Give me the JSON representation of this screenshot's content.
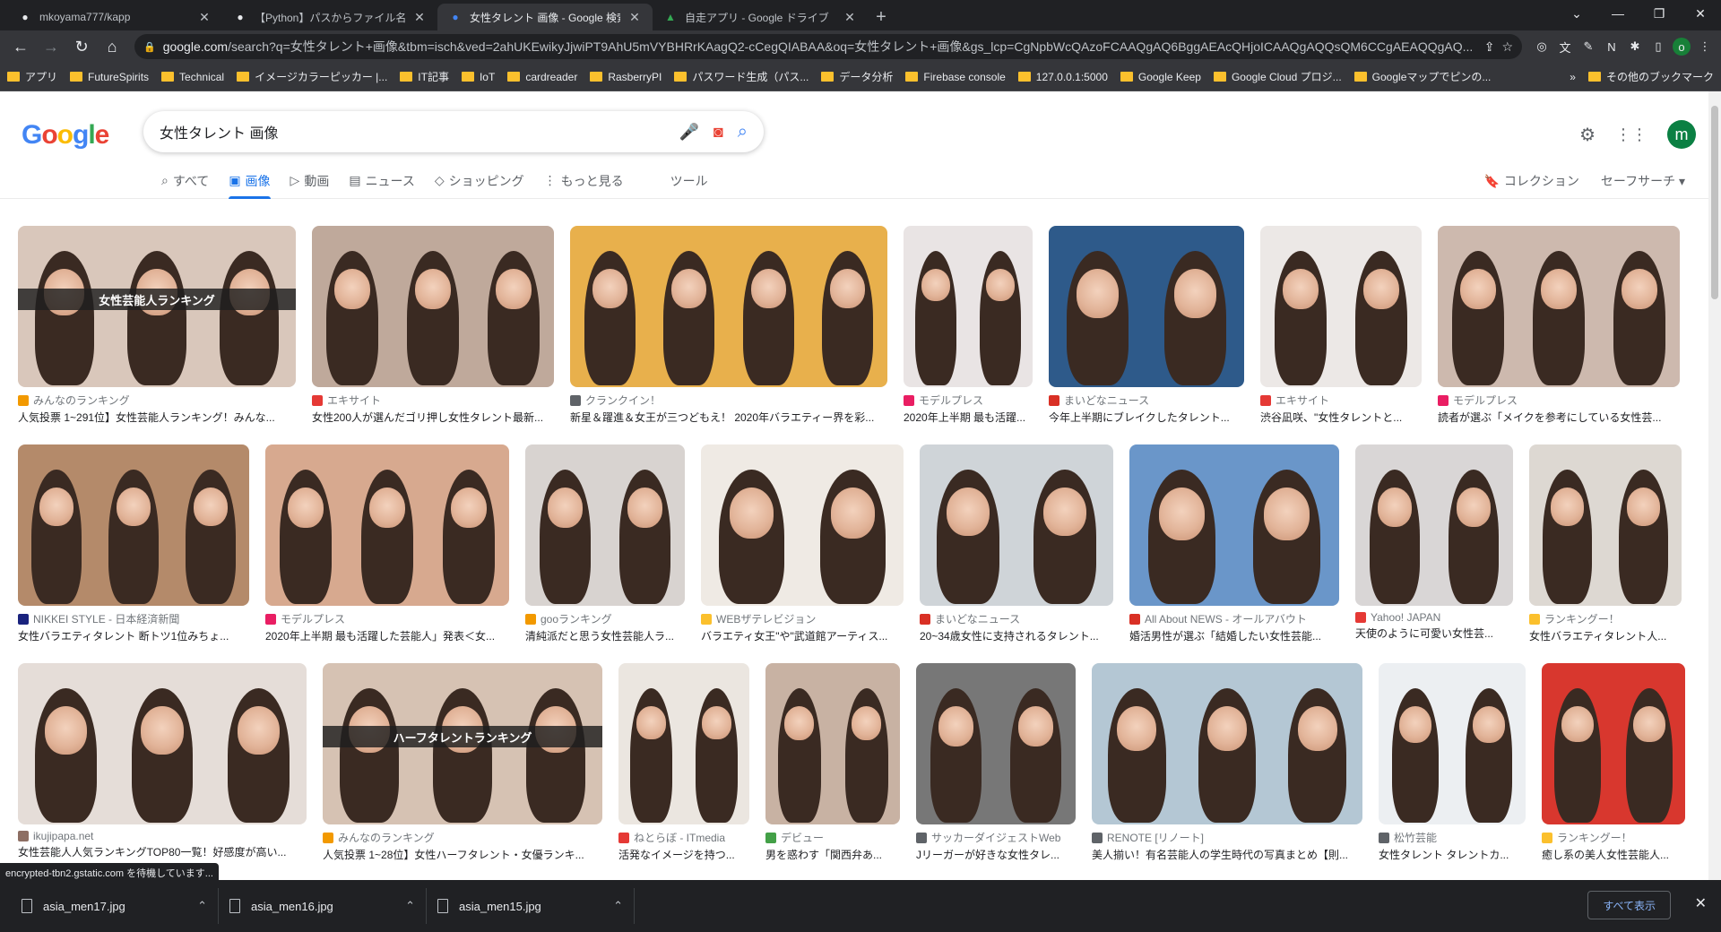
{
  "browser": {
    "tabs": [
      {
        "title": "mkoyama777/kapp",
        "icon": "github-icon",
        "active": false
      },
      {
        "title": "【Python】パスからファイル名（拡張子",
        "icon": "globe-icon",
        "active": false
      },
      {
        "title": "女性タレント 画像 - Google 検索",
        "icon": "google-icon",
        "active": true
      },
      {
        "title": "自走アプリ - Google ドライブ",
        "icon": "drive-icon",
        "active": false
      }
    ],
    "url_domain": "google.com",
    "url_rest": "/search?q=女性タレント+画像&tbm=isch&ved=2ahUKEwikyJjwiPT9AhU5mVYBHRrKAagQ2-cCegQIABAA&oq=女性タレント+画像&gs_lcp=CgNpbWcQAzoFCAAQgAQ6BggAEAcQHjoICAAQgAQQsQM6CCgAEAQQgAQ...",
    "profile_initial": "o",
    "bookmarks": [
      "アプリ",
      "FutureSpirits",
      "Technical",
      "イメージカラーピッカー |...",
      "IT記事",
      "IoT",
      "cardreader",
      "RasberryPI",
      "パスワード生成（パス...",
      "データ分析",
      "Firebase console",
      "127.0.0.1:5000",
      "Google Keep",
      "Google Cloud プロジ...",
      "Googleマップでピンの..."
    ],
    "bookmarks_more": "»",
    "other_bookmarks": "その他のブックマーク"
  },
  "google": {
    "logo": "Google",
    "query": "女性タレント 画像",
    "profile_initial": "m",
    "search_tabs": [
      {
        "label": "すべて",
        "icon": "search-icon",
        "active": false
      },
      {
        "label": "画像",
        "icon": "image-icon",
        "active": true
      },
      {
        "label": "動画",
        "icon": "video-icon",
        "active": false
      },
      {
        "label": "ニュース",
        "icon": "news-icon",
        "active": false
      },
      {
        "label": "ショッピング",
        "icon": "tag-icon",
        "active": false
      },
      {
        "label": "もっと見る",
        "icon": "more-vert-icon",
        "active": false
      }
    ],
    "tools": "ツール",
    "collections": "コレクション",
    "safesearch": "セーフサーチ ▾"
  },
  "results": {
    "row1": [
      {
        "source": "みんなのランキング",
        "title": "人気投票 1~291位】女性芸能人ランキング！みんな...",
        "banner": "女性芸能人ランキング",
        "w": 310,
        "bg": "#d9c7bb",
        "src_color": "#f29900"
      },
      {
        "source": "エキサイト",
        "title": "女性200人が選んだゴリ押し女性タレント最新...",
        "banner": "",
        "w": 270,
        "bg": "#bfa99b",
        "src_color": "#e53935"
      },
      {
        "source": "クランクイン！",
        "title": "新星＆躍進＆女王が三つどもえ！ 2020年バラエティー界を彩...",
        "banner": "",
        "w": 354,
        "bg": "#e8b04c",
        "src_color": "#5f6368"
      },
      {
        "source": "モデルプレス",
        "title": "2020年上半期 最も活躍...",
        "banner": "",
        "w": 144,
        "bg": "#e9e4e4",
        "src_color": "#e91e63"
      },
      {
        "source": "まいどなニュース",
        "title": "今年上半期にブレイクしたタレント...",
        "banner": "",
        "w": 218,
        "bg": "#2e5a8a",
        "src_color": "#d93025"
      },
      {
        "source": "エキサイト",
        "title": "渋谷凪咲、\"女性タレントと...",
        "banner": "",
        "w": 180,
        "bg": "#ece8e6",
        "src_color": "#e53935"
      },
      {
        "source": "モデルプレス",
        "title": "読者が選ぶ「メイクを参考にしている女性芸...",
        "banner": "",
        "w": 270,
        "bg": "#cdb9ae",
        "src_color": "#e91e63"
      }
    ],
    "row2": [
      {
        "source": "NIKKEI STYLE - 日本経済新聞",
        "title": "女性バラエティタレント 断トツ1位みちょ...",
        "banner": "",
        "w": 258,
        "bg": "#b48a6a",
        "src_color": "#1a237e"
      },
      {
        "source": "モデルプレス",
        "title": "2020年上半期 最も活躍した芸能人」発表＜女...",
        "banner": "",
        "w": 272,
        "bg": "#d7a98f",
        "src_color": "#e91e63"
      },
      {
        "source": "gooランキング",
        "title": "清純派だと思う女性芸能人ラ...",
        "banner": "",
        "w": 178,
        "bg": "#d8d3d0",
        "src_color": "#f29900"
      },
      {
        "source": "WEBザテレビジョン",
        "title": "バラエティ女王\"や\"武道館アーティス...",
        "banner": "",
        "w": 226,
        "bg": "#efeae4",
        "src_color": "#fbc02d"
      },
      {
        "source": "まいどなニュース",
        "title": "20~34歳女性に支持されるタレント...",
        "banner": "",
        "w": 216,
        "bg": "#cfd4d8",
        "src_color": "#d93025"
      },
      {
        "source": "All About NEWS - オールアバウト",
        "title": "婚活男性が選ぶ「結婚したい女性芸能...",
        "banner": "",
        "w": 234,
        "bg": "#6a96c9",
        "src_color": "#d93025"
      },
      {
        "source": "Yahoo! JAPAN",
        "title": "天使のように可愛い女性芸...",
        "banner": "",
        "w": 176,
        "bg": "#d9d6d6",
        "src_color": "#e53935"
      },
      {
        "source": "ランキングー！",
        "title": "女性バラエティタレント人...",
        "banner": "",
        "w": 170,
        "bg": "#ddd8d2",
        "src_color": "#fbc02d"
      }
    ],
    "row3": [
      {
        "source": "ikujipapa.net",
        "title": "女性芸能人人気ランキングTOP80一覧！好感度が高い...",
        "banner": "",
        "w": 322,
        "bg": "#e5ddd8",
        "src_color": "#8d6e63"
      },
      {
        "source": "みんなのランキング",
        "title": "人気投票 1~28位】女性ハーフタレント・女優ランキ...",
        "banner": "ハーフタレントランキング",
        "w": 312,
        "bg": "#d6c2b3",
        "src_color": "#f29900"
      },
      {
        "source": "ねとらぼ - ITmedia",
        "title": "活発なイメージを持つ...",
        "banner": "",
        "w": 146,
        "bg": "#ebe6e0",
        "src_color": "#e53935"
      },
      {
        "source": "デビュー",
        "title": "男を惑わす「関西弁あ...",
        "banner": "",
        "w": 150,
        "bg": "#c8b2a3",
        "src_color": "#43a047"
      },
      {
        "source": "サッカーダイジェストWeb",
        "title": "Jリーガーが好きな女性タレ...",
        "banner": "",
        "w": 178,
        "bg": "#777777",
        "src_color": "#5f6368"
      },
      {
        "source": "RENOTE [リノート]",
        "title": "美人揃い！有名芸能人の学生時代の写真まとめ【則...",
        "banner": "",
        "w": 302,
        "bg": "#b4c7d4",
        "src_color": "#5f6368"
      },
      {
        "source": "松竹芸能",
        "title": "女性タレント タレントカ...",
        "banner": "",
        "w": 164,
        "bg": "#eceff2",
        "src_color": "#5f6368"
      },
      {
        "source": "ランキングー！",
        "title": "癒し系の美人女性芸能人...",
        "banner": "",
        "w": 160,
        "bg": "#d8372e",
        "src_color": "#fbc02d"
      }
    ]
  },
  "status": "encrypted-tbn2.gstatic.com を待機しています...",
  "downloads": {
    "items": [
      "asia_men17.jpg",
      "asia_men16.jpg",
      "asia_men15.jpg"
    ],
    "show_all": "すべて表示"
  }
}
